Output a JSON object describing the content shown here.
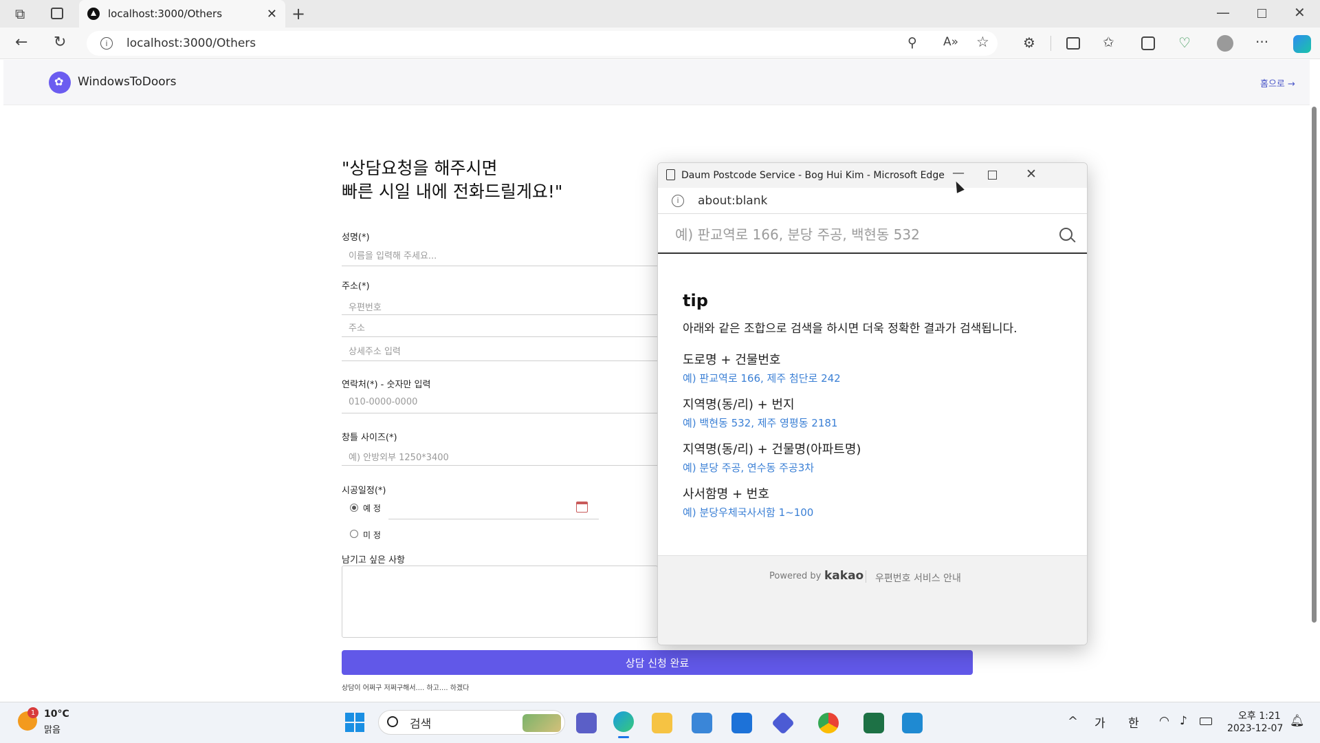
{
  "browser": {
    "tab_title": "localhost:3000/Others",
    "url": "localhost:3000/Others"
  },
  "app": {
    "brand": "WindowsToDoors",
    "home_link": "홈으로 →"
  },
  "form": {
    "heading_line1": "\"상담요청을 해주시면",
    "heading_line2": "빠른 시일 내에 전화드릴게요!\"",
    "name_label": "성명(*)",
    "name_placeholder": "이름을 입력해 주세요...",
    "address_label": "주소(*)",
    "postcode_placeholder": "우편번호",
    "address_placeholder": "주소",
    "detail_placeholder": "상세주소 입력",
    "phone_label": "연락처(*) - 숫자만 입력",
    "phone_placeholder": "010-0000-0000",
    "size_label": "창틀 사이즈(*)",
    "size_placeholder": "예) 안방외부 1250*3400",
    "schedule_label": "시공일정(*)",
    "schedule_option1": "예 정",
    "schedule_option2": "미 정",
    "notes_label": "남기고 싶은 사항",
    "submit": "상담 신청 완료",
    "footnote": "상담이 어쩌구 저쩌구해서.... 하고.... 하겠다"
  },
  "popup": {
    "title": "Daum Postcode Service - Bog Hui Kim - Microsoft Edge",
    "url": "about:blank",
    "search_placeholder": "예) 판교역로 166, 분당 주공, 백현동 532",
    "tip_title": "tip",
    "tip_desc": "아래와 같은 조합으로 검색을 하시면 더욱 정확한 결과가 검색됩니다.",
    "tips": [
      {
        "category": "도로명 + 건물번호",
        "example": "예) 판교역로 166,  제주 첨단로 242"
      },
      {
        "category": "지역명(동/리) + 번지",
        "example": "예) 백현동 532,  제주 영평동 2181"
      },
      {
        "category": "지역명(동/리) + 건물명(아파트명)",
        "example": "예) 분당 주공,  연수동 주공3차"
      },
      {
        "category": "사서함명 + 번호",
        "example": "예) 분당우체국사서함 1~100"
      }
    ],
    "powered_by": "Powered by",
    "powered_brand": "kakao",
    "service_info": "우편번호 서비스 안내"
  },
  "taskbar": {
    "weather_temp": "10°C",
    "weather_desc": "맑음",
    "weather_badge": "1",
    "search_placeholder": "검색",
    "ime1": "가",
    "ime2": "한",
    "time": "오후 1:21",
    "date": "2023-12-07"
  }
}
